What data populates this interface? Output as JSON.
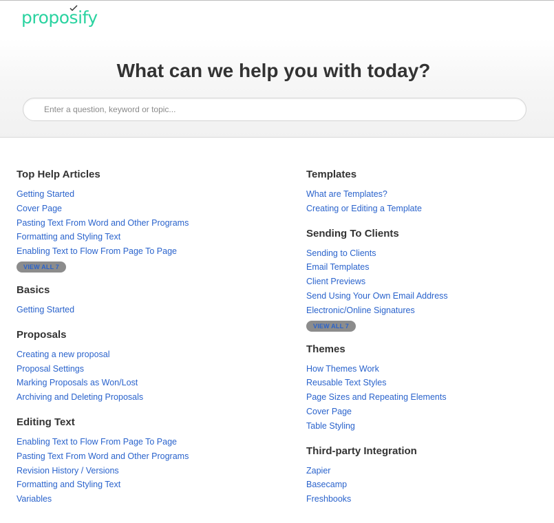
{
  "brand": {
    "name": "proposify"
  },
  "hero": {
    "title": "What can we help you with today?",
    "search_placeholder": "Enter a question, keyword or topic..."
  },
  "left_sections": [
    {
      "title": "Top Help Articles",
      "links": [
        "Getting Started",
        "Cover Page",
        "Pasting Text From Word and Other Programs",
        "Formatting and Styling Text",
        "Enabling Text to Flow From Page To Page"
      ],
      "view_all": "VIEW ALL 7"
    },
    {
      "title": "Basics",
      "links": [
        "Getting Started"
      ]
    },
    {
      "title": "Proposals",
      "links": [
        "Creating a new proposal",
        "Proposal Settings",
        "Marking Proposals as Won/Lost",
        "Archiving and Deleting Proposals"
      ]
    },
    {
      "title": "Editing Text",
      "links": [
        "Enabling Text to Flow From Page To Page",
        "Pasting Text From Word and Other Programs",
        "Revision History / Versions",
        "Formatting and Styling Text",
        "Variables"
      ]
    }
  ],
  "right_sections": [
    {
      "title": "Templates",
      "links": [
        "What are Templates?",
        "Creating or Editing a Template"
      ]
    },
    {
      "title": "Sending To Clients",
      "links": [
        "Sending to Clients",
        "Email Templates",
        "Client Previews",
        "Send Using Your Own Email Address",
        "Electronic/Online Signatures"
      ],
      "view_all": "VIEW ALL 7"
    },
    {
      "title": "Themes",
      "links": [
        "How Themes Work",
        "Reusable Text Styles",
        "Page Sizes and Repeating Elements",
        "Cover Page",
        "Table Styling"
      ]
    },
    {
      "title": "Third-party Integration",
      "links": [
        "Zapier",
        "Basecamp",
        "Freshbooks"
      ]
    }
  ],
  "colors": {
    "brand": "#2ad3a0",
    "link": "#2a63cc",
    "badge": "#8c8c8c"
  }
}
